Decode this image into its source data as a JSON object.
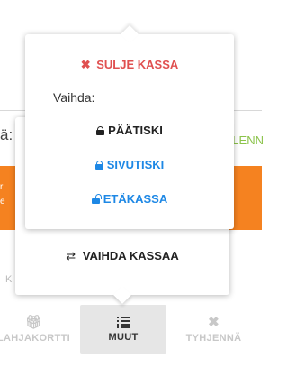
{
  "background": {
    "left_label": "ä:",
    "right_label": "ALENN",
    "orange_marks": [
      "r",
      "e"
    ],
    "faint_label": "K",
    "bottom_nav": {
      "gift": {
        "icon": "gift-icon",
        "label": "LAHJAKORTTI"
      },
      "more": {
        "icon": "list-icon",
        "label": "MUUT"
      },
      "clear": {
        "icon": "close-icon",
        "label": "TYHJENNÄ"
      }
    }
  },
  "lower_popup": {
    "switch_button": {
      "icon": "exchange-icon",
      "label": "VAIHDA KASSAA"
    }
  },
  "upper_popup": {
    "close_button": {
      "icon": "close-icon",
      "label": "SULJE KASSA",
      "color": "#e05050"
    },
    "switch_label": "Vaihda:",
    "options": [
      {
        "label": "PÄÄTISKI",
        "icon": "lock-icon",
        "color": "#222222"
      },
      {
        "label": "SIVUTISKI",
        "icon": "lock-icon",
        "color": "#1e88e5"
      },
      {
        "label": "ETÄKASSA",
        "icon": "unlock-icon",
        "color": "#1e88e5"
      }
    ]
  },
  "colors": {
    "orange_banner": "#f58220",
    "accent_green": "#8bc34a"
  }
}
